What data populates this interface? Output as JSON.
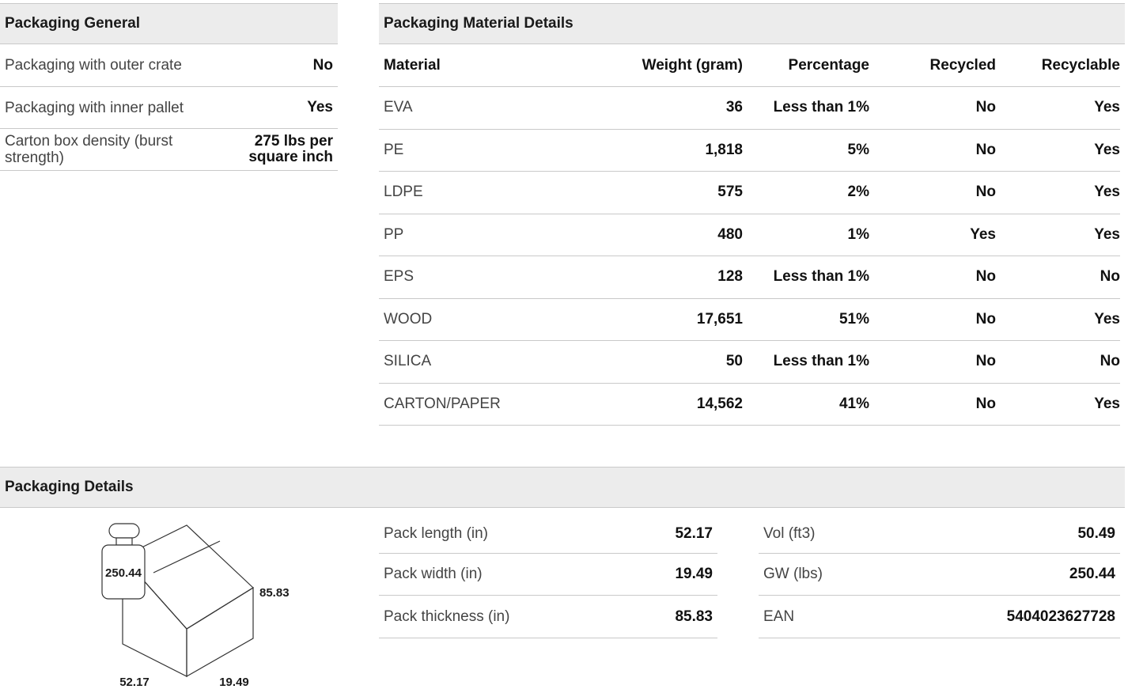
{
  "general": {
    "title": "Packaging General",
    "rows": [
      {
        "label": "Packaging with outer crate",
        "value": "No"
      },
      {
        "label": "Packaging with inner pallet",
        "value": "Yes"
      },
      {
        "label": "Carton box density (burst strength)",
        "value": "275 lbs per square inch"
      }
    ]
  },
  "materials": {
    "title": "Packaging Material Details",
    "headers": [
      "Material",
      "Weight (gram)",
      "Percentage",
      "Recycled",
      "Recyclable"
    ],
    "rows": [
      [
        "EVA",
        "36",
        "Less than 1%",
        "No",
        "Yes"
      ],
      [
        "PE",
        "1,818",
        "5%",
        "No",
        "Yes"
      ],
      [
        "LDPE",
        "575",
        "2%",
        "No",
        "Yes"
      ],
      [
        "PP",
        "480",
        "1%",
        "Yes",
        "Yes"
      ],
      [
        "EPS",
        "128",
        "Less than 1%",
        "No",
        "No"
      ],
      [
        "WOOD",
        "17,651",
        "51%",
        "No",
        "Yes"
      ],
      [
        "SILICA",
        "50",
        "Less than 1%",
        "No",
        "No"
      ],
      [
        "CARTON/PAPER",
        "14,562",
        "41%",
        "No",
        "Yes"
      ]
    ]
  },
  "details": {
    "title": "Packaging Details",
    "left": [
      {
        "label": "Pack length (in)",
        "value": "52.17"
      },
      {
        "label": "Pack width (in)",
        "value": "19.49"
      },
      {
        "label": "Pack thickness (in)",
        "value": "85.83"
      }
    ],
    "right": [
      {
        "label": "Vol (ft3)",
        "value": "50.49"
      },
      {
        "label": "GW (lbs)",
        "value": "250.44"
      },
      {
        "label": "EAN",
        "value": "5404023627728"
      }
    ],
    "diagram": {
      "weight": "250.44",
      "height": "85.83",
      "length": "52.17",
      "width": "19.49"
    }
  }
}
